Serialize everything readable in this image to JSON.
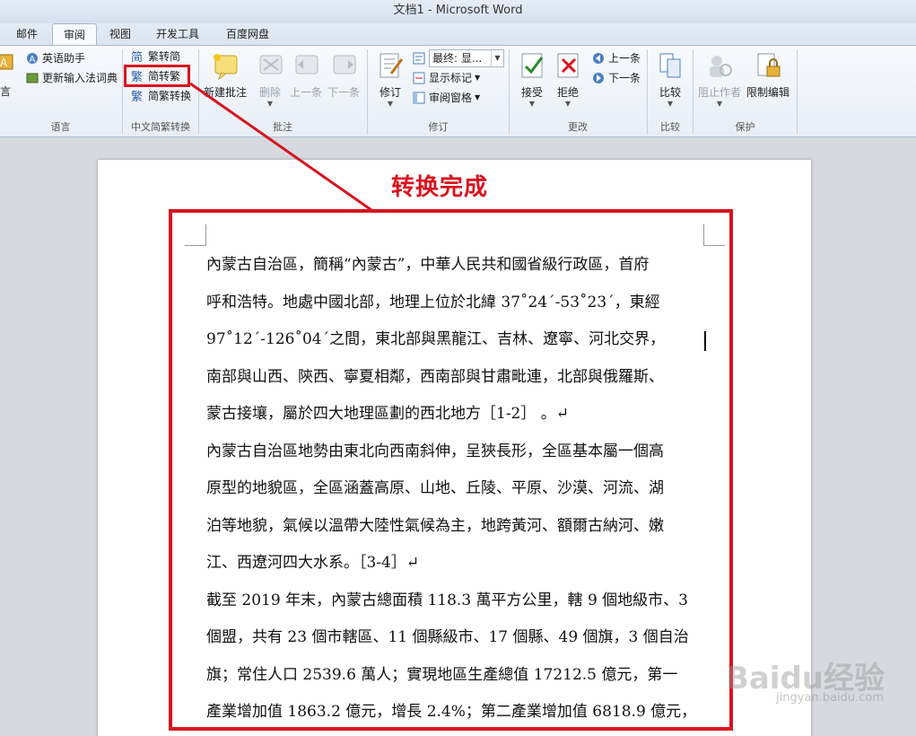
{
  "window": {
    "title": "文档1 - Microsoft Word"
  },
  "tabs": [
    {
      "label": "邮件"
    },
    {
      "label": "审阅",
      "active": true
    },
    {
      "label": "视图"
    },
    {
      "label": "开发工具"
    },
    {
      "label": "百度网盘"
    }
  ],
  "ribbon": {
    "language": {
      "partial_label": "言",
      "english_assistant": "英语助手",
      "update_ime": "更新输入法词典",
      "group_label": "语言"
    },
    "convert": {
      "to_simplified": "繁转简",
      "to_traditional": "简转繁",
      "conversion": "简繁转换",
      "group_label": "中文简繁转换"
    },
    "comments": {
      "new_comment": "新建批注",
      "delete": "删除",
      "previous": "上一条",
      "next": "下一条",
      "group_label": "批注"
    },
    "tracking": {
      "track_changes": "修订",
      "display_value": "最终: 显...",
      "show_markup": "显示标记",
      "reviewing_pane": "审阅窗格",
      "group_label": "修订"
    },
    "changes": {
      "accept": "接受",
      "reject": "拒绝",
      "previous": "上一条",
      "next": "下一条",
      "group_label": "更改"
    },
    "compare": {
      "compare": "比较",
      "group_label": "比较"
    },
    "protect": {
      "block_authors": "阻止作者",
      "restrict_editing": "限制编辑",
      "group_label": "保护"
    }
  },
  "annotation": {
    "label": "转换完成"
  },
  "document": {
    "lines": [
      "內蒙古自治區，簡稱“內蒙古”，中華人民共和國省級行政區，首府",
      "呼和浩特。地處中國北部，地理上位於北緯 37˚24´-53˚23´，東經",
      "97˚12´-126˚04´之間，東北部與黑龍江、吉林、遼寧、河北交界，",
      "南部與山西、陝西、寧夏相鄰，西南部與甘肅毗連，北部與俄羅斯、",
      "蒙古接壤，屬於四大地理區劃的西北地方［1-2］ 。↵",
      "內蒙古自治區地勢由東北向西南斜伸，呈狹長形，全區基本屬一個高",
      "原型的地貌區，全區涵蓋高原、山地、丘陵、平原、沙漠、河流、湖",
      "泊等地貌，氣候以溫帶大陸性氣候為主，地跨黃河、額爾古納河、嫩",
      "江、西遼河四大水系。［3-4］↵",
      "截至 2019 年末，內蒙古總面積 118.3 萬平方公里，轄 9 個地級市、3",
      "個盟，共有 23 個市轄區、11 個縣級市、17 個縣、49 個旗，3 個自治",
      "旗；常住人口 2539.6 萬人；實現地區生產總值 17212.5 億元，第一",
      "產業增加值 1863.2 億元，增長 2.4%；第二產業增加值 6818.9 億元，"
    ]
  },
  "watermark": {
    "main": "Baidu经验",
    "sub": "jingyan.baidu.com"
  }
}
